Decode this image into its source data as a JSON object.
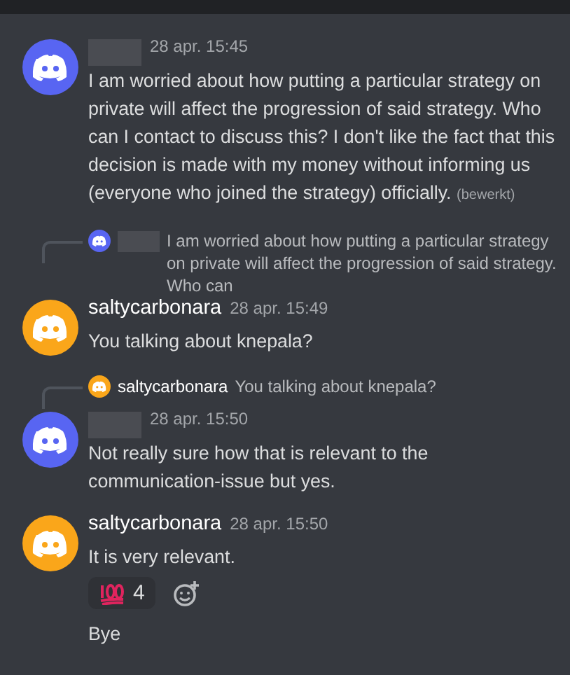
{
  "messages": [
    {
      "color": "#5865f2",
      "author_hidden": true,
      "timestamp": "28 apr. 15:45",
      "text": "I am worried about how putting a particular strategy on private will affect the progression of said strategy. Who can I contact to discuss this? I don't like the fact that this decision is made with my money without informing us (everyone who joined the strategy) officially.",
      "edited": "(bewerkt)"
    },
    {
      "color": "#faa61a",
      "author_hidden": false,
      "author": "saltycarbonara",
      "timestamp": "28 apr. 15:49",
      "text": "You talking about knepala?",
      "reply": {
        "color": "#5865f2",
        "author_hidden": true,
        "text": "I am worried about how putting a particular strategy on private will affect the progression of said strategy. Who can"
      }
    },
    {
      "color": "#5865f2",
      "author_hidden": true,
      "timestamp": "28 apr. 15:50",
      "text": "Not really sure how that is relevant to the communication-issue but yes.",
      "reply": {
        "color": "#faa61a",
        "author_hidden": false,
        "author": "saltycarbonara",
        "text": "You talking about knepala?"
      }
    },
    {
      "color": "#faa61a",
      "author_hidden": false,
      "author": "saltycarbonara",
      "timestamp": "28 apr. 15:50",
      "text": "It is very relevant.",
      "reactions": [
        {
          "count": "4"
        }
      ],
      "followups": [
        "Bye"
      ]
    }
  ]
}
